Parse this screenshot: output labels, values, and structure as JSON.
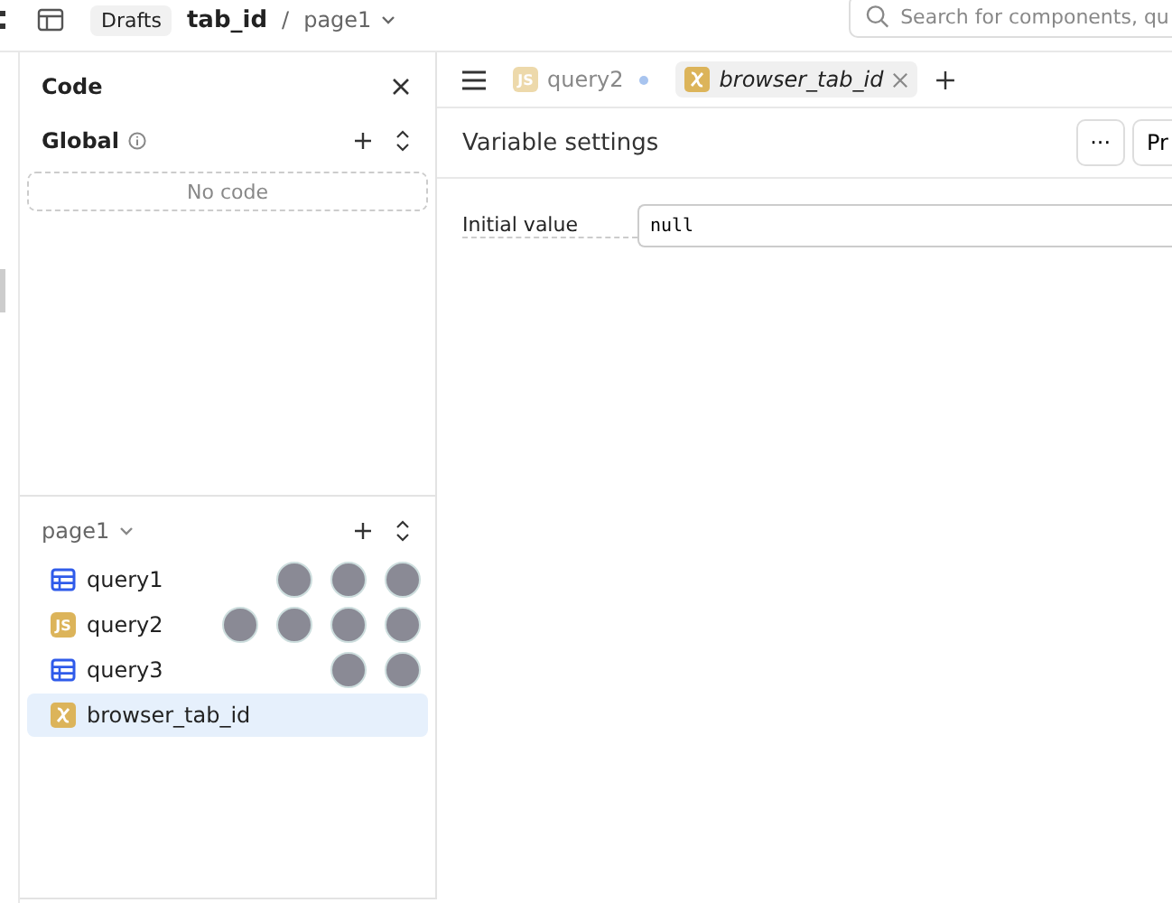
{
  "top_bar": {
    "breadcrumb_tag": "Drafts",
    "app_name": "tab_id",
    "separator": "/",
    "page": "page1",
    "search": {
      "placeholder": "Search for components, qu"
    }
  },
  "code_panel": {
    "title": "Code",
    "global": {
      "label": "Global",
      "empty_text": "No code"
    },
    "page_section": {
      "label": "page1",
      "items": [
        {
          "name": "query1",
          "kind": "table",
          "selected": false,
          "viewers": [
            {
              "kind": "photo"
            },
            {
              "kind": "photo"
            },
            {
              "kind": "photo"
            }
          ]
        },
        {
          "name": "query2",
          "kind": "js",
          "badge": "JS",
          "selected": false,
          "viewers": [
            {
              "kind": "photo"
            },
            {
              "kind": "photo"
            },
            {
              "kind": "photo"
            },
            {
              "kind": "photo"
            }
          ]
        },
        {
          "name": "query3",
          "kind": "table",
          "selected": false,
          "viewers": [
            {
              "kind": "photo"
            },
            {
              "kind": "photo"
            }
          ]
        },
        {
          "name": "browser_tab_id",
          "kind": "variable",
          "selected": true
        }
      ]
    }
  },
  "editor": {
    "tabs": [
      {
        "label": "query2",
        "kind": "js",
        "badge": "JS",
        "selected": false,
        "unsaved": true
      },
      {
        "label": "browser_tab_id",
        "kind": "variable",
        "selected": true,
        "unsaved": false
      }
    ],
    "title": "Variable settings",
    "more_button": "···",
    "cut_button": "Pr",
    "fields": [
      {
        "label": "Initial value",
        "value": "null"
      }
    ]
  }
}
